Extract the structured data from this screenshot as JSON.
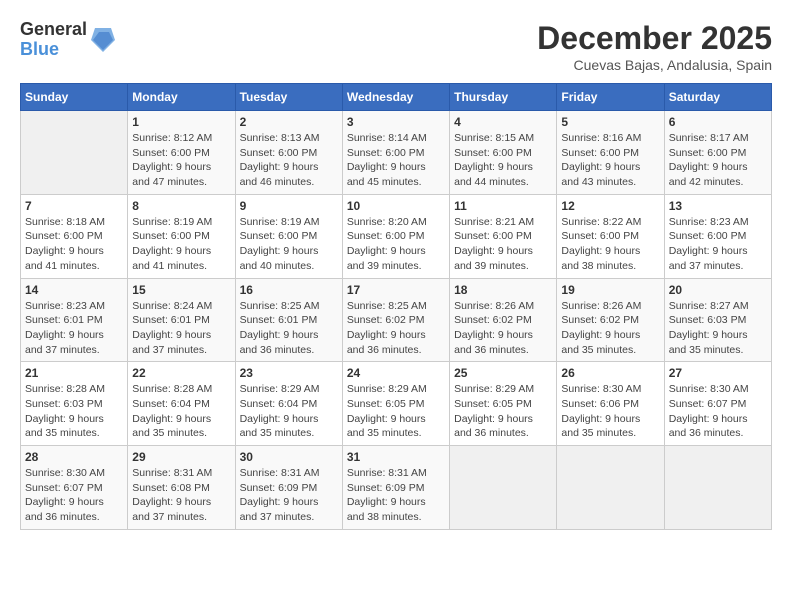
{
  "logo": {
    "general": "General",
    "blue": "Blue"
  },
  "title": "December 2025",
  "subtitle": "Cuevas Bajas, Andalusia, Spain",
  "days_of_week": [
    "Sunday",
    "Monday",
    "Tuesday",
    "Wednesday",
    "Thursday",
    "Friday",
    "Saturday"
  ],
  "weeks": [
    [
      {
        "day": "",
        "sunrise": "",
        "sunset": "",
        "daylight": ""
      },
      {
        "day": "1",
        "sunrise": "Sunrise: 8:12 AM",
        "sunset": "Sunset: 6:00 PM",
        "daylight": "Daylight: 9 hours and 47 minutes."
      },
      {
        "day": "2",
        "sunrise": "Sunrise: 8:13 AM",
        "sunset": "Sunset: 6:00 PM",
        "daylight": "Daylight: 9 hours and 46 minutes."
      },
      {
        "day": "3",
        "sunrise": "Sunrise: 8:14 AM",
        "sunset": "Sunset: 6:00 PM",
        "daylight": "Daylight: 9 hours and 45 minutes."
      },
      {
        "day": "4",
        "sunrise": "Sunrise: 8:15 AM",
        "sunset": "Sunset: 6:00 PM",
        "daylight": "Daylight: 9 hours and 44 minutes."
      },
      {
        "day": "5",
        "sunrise": "Sunrise: 8:16 AM",
        "sunset": "Sunset: 6:00 PM",
        "daylight": "Daylight: 9 hours and 43 minutes."
      },
      {
        "day": "6",
        "sunrise": "Sunrise: 8:17 AM",
        "sunset": "Sunset: 6:00 PM",
        "daylight": "Daylight: 9 hours and 42 minutes."
      }
    ],
    [
      {
        "day": "7",
        "sunrise": "Sunrise: 8:18 AM",
        "sunset": "Sunset: 6:00 PM",
        "daylight": "Daylight: 9 hours and 41 minutes."
      },
      {
        "day": "8",
        "sunrise": "Sunrise: 8:19 AM",
        "sunset": "Sunset: 6:00 PM",
        "daylight": "Daylight: 9 hours and 41 minutes."
      },
      {
        "day": "9",
        "sunrise": "Sunrise: 8:19 AM",
        "sunset": "Sunset: 6:00 PM",
        "daylight": "Daylight: 9 hours and 40 minutes."
      },
      {
        "day": "10",
        "sunrise": "Sunrise: 8:20 AM",
        "sunset": "Sunset: 6:00 PM",
        "daylight": "Daylight: 9 hours and 39 minutes."
      },
      {
        "day": "11",
        "sunrise": "Sunrise: 8:21 AM",
        "sunset": "Sunset: 6:00 PM",
        "daylight": "Daylight: 9 hours and 39 minutes."
      },
      {
        "day": "12",
        "sunrise": "Sunrise: 8:22 AM",
        "sunset": "Sunset: 6:00 PM",
        "daylight": "Daylight: 9 hours and 38 minutes."
      },
      {
        "day": "13",
        "sunrise": "Sunrise: 8:23 AM",
        "sunset": "Sunset: 6:00 PM",
        "daylight": "Daylight: 9 hours and 37 minutes."
      }
    ],
    [
      {
        "day": "14",
        "sunrise": "Sunrise: 8:23 AM",
        "sunset": "Sunset: 6:01 PM",
        "daylight": "Daylight: 9 hours and 37 minutes."
      },
      {
        "day": "15",
        "sunrise": "Sunrise: 8:24 AM",
        "sunset": "Sunset: 6:01 PM",
        "daylight": "Daylight: 9 hours and 37 minutes."
      },
      {
        "day": "16",
        "sunrise": "Sunrise: 8:25 AM",
        "sunset": "Sunset: 6:01 PM",
        "daylight": "Daylight: 9 hours and 36 minutes."
      },
      {
        "day": "17",
        "sunrise": "Sunrise: 8:25 AM",
        "sunset": "Sunset: 6:02 PM",
        "daylight": "Daylight: 9 hours and 36 minutes."
      },
      {
        "day": "18",
        "sunrise": "Sunrise: 8:26 AM",
        "sunset": "Sunset: 6:02 PM",
        "daylight": "Daylight: 9 hours and 36 minutes."
      },
      {
        "day": "19",
        "sunrise": "Sunrise: 8:26 AM",
        "sunset": "Sunset: 6:02 PM",
        "daylight": "Daylight: 9 hours and 35 minutes."
      },
      {
        "day": "20",
        "sunrise": "Sunrise: 8:27 AM",
        "sunset": "Sunset: 6:03 PM",
        "daylight": "Daylight: 9 hours and 35 minutes."
      }
    ],
    [
      {
        "day": "21",
        "sunrise": "Sunrise: 8:28 AM",
        "sunset": "Sunset: 6:03 PM",
        "daylight": "Daylight: 9 hours and 35 minutes."
      },
      {
        "day": "22",
        "sunrise": "Sunrise: 8:28 AM",
        "sunset": "Sunset: 6:04 PM",
        "daylight": "Daylight: 9 hours and 35 minutes."
      },
      {
        "day": "23",
        "sunrise": "Sunrise: 8:29 AM",
        "sunset": "Sunset: 6:04 PM",
        "daylight": "Daylight: 9 hours and 35 minutes."
      },
      {
        "day": "24",
        "sunrise": "Sunrise: 8:29 AM",
        "sunset": "Sunset: 6:05 PM",
        "daylight": "Daylight: 9 hours and 35 minutes."
      },
      {
        "day": "25",
        "sunrise": "Sunrise: 8:29 AM",
        "sunset": "Sunset: 6:05 PM",
        "daylight": "Daylight: 9 hours and 36 minutes."
      },
      {
        "day": "26",
        "sunrise": "Sunrise: 8:30 AM",
        "sunset": "Sunset: 6:06 PM",
        "daylight": "Daylight: 9 hours and 35 minutes."
      },
      {
        "day": "27",
        "sunrise": "Sunrise: 8:30 AM",
        "sunset": "Sunset: 6:07 PM",
        "daylight": "Daylight: 9 hours and 36 minutes."
      }
    ],
    [
      {
        "day": "28",
        "sunrise": "Sunrise: 8:30 AM",
        "sunset": "Sunset: 6:07 PM",
        "daylight": "Daylight: 9 hours and 36 minutes."
      },
      {
        "day": "29",
        "sunrise": "Sunrise: 8:31 AM",
        "sunset": "Sunset: 6:08 PM",
        "daylight": "Daylight: 9 hours and 37 minutes."
      },
      {
        "day": "30",
        "sunrise": "Sunrise: 8:31 AM",
        "sunset": "Sunset: 6:09 PM",
        "daylight": "Daylight: 9 hours and 37 minutes."
      },
      {
        "day": "31",
        "sunrise": "Sunrise: 8:31 AM",
        "sunset": "Sunset: 6:09 PM",
        "daylight": "Daylight: 9 hours and 38 minutes."
      },
      {
        "day": "",
        "sunrise": "",
        "sunset": "",
        "daylight": ""
      },
      {
        "day": "",
        "sunrise": "",
        "sunset": "",
        "daylight": ""
      },
      {
        "day": "",
        "sunrise": "",
        "sunset": "",
        "daylight": ""
      }
    ]
  ]
}
